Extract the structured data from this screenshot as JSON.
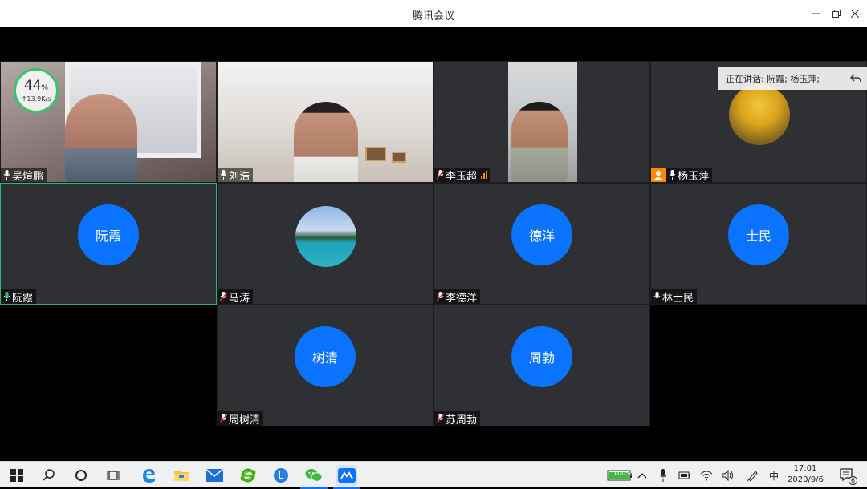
{
  "window": {
    "title": "腾讯会议"
  },
  "speaking": {
    "label": "正在讲话: 阮霞; 杨玉萍;"
  },
  "network": {
    "percent": "44",
    "percent_unit": "%",
    "rate": "↑13.9K/s"
  },
  "participants": [
    {
      "name": "吴煊鹏"
    },
    {
      "name": "刘浩"
    },
    {
      "name": "李玉超"
    },
    {
      "name": "杨玉萍"
    },
    {
      "name": "阮霞",
      "avatar": "阮霞"
    },
    {
      "name": "马涛"
    },
    {
      "name": "李德洋",
      "avatar": "德洋"
    },
    {
      "name": "林士民",
      "avatar": "士民"
    },
    {
      "name": "周树清",
      "avatar": "树清"
    },
    {
      "name": "苏周勃",
      "avatar": "周勃"
    }
  ],
  "taskbar": {
    "battery": "100%",
    "ime": "中",
    "time": "17:01",
    "date": "2020/9/6",
    "notifications": "6"
  },
  "colors": {
    "avatar_blue": "#0a73ff",
    "tile_bg": "#2f3034",
    "active_border": "#2bb673"
  }
}
